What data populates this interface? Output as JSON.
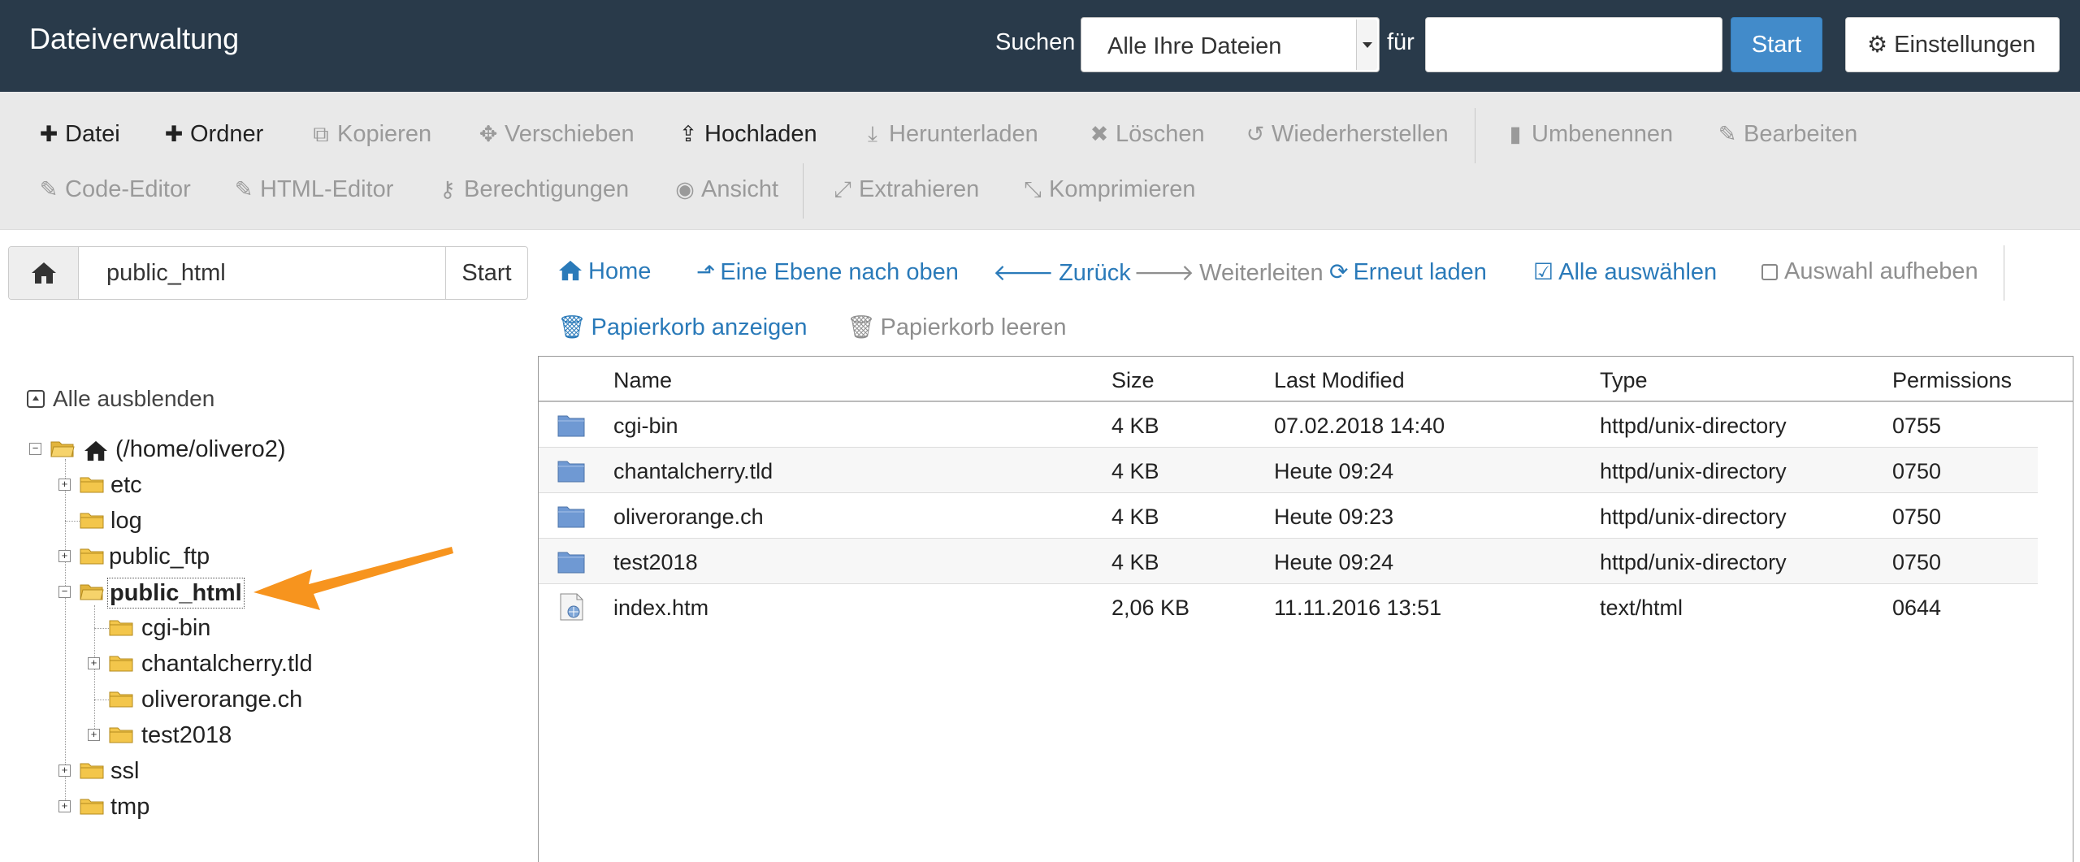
{
  "header": {
    "title": "Dateiverwaltung",
    "search_label": "Suchen",
    "search_scope": "Alle Ihre Dateien",
    "for_label": "für",
    "search_value": "",
    "start_label": "Start",
    "settings_label": "Einstellungen"
  },
  "toolbar": {
    "row1": [
      {
        "label": "Datei",
        "icon": "plus-icon",
        "enabled": true
      },
      {
        "label": "Ordner",
        "icon": "plus-icon",
        "enabled": true
      },
      {
        "label": "Kopieren",
        "icon": "copy-icon",
        "enabled": false
      },
      {
        "label": "Verschieben",
        "icon": "move-icon",
        "enabled": false
      },
      {
        "label": "Hochladen",
        "icon": "upload-icon",
        "enabled": true
      },
      {
        "label": "Herunterladen",
        "icon": "download-icon",
        "enabled": false
      },
      {
        "label": "Löschen",
        "icon": "delete-icon",
        "enabled": false
      },
      {
        "label": "Wiederherstellen",
        "icon": "restore-icon",
        "enabled": false
      },
      {
        "label": "Umbenennen",
        "icon": "file-icon",
        "enabled": false
      },
      {
        "label": "Bearbeiten",
        "icon": "pencil-icon",
        "enabled": false
      }
    ],
    "row2": [
      {
        "label": "Code-Editor",
        "icon": "edit-icon",
        "enabled": false
      },
      {
        "label": "HTML-Editor",
        "icon": "edit-icon",
        "enabled": false
      },
      {
        "label": "Berechtigungen",
        "icon": "key-icon",
        "enabled": false
      },
      {
        "label": "Ansicht",
        "icon": "eye-icon",
        "enabled": false
      },
      {
        "label": "Extrahieren",
        "icon": "expand-icon",
        "enabled": false
      },
      {
        "label": "Komprimieren",
        "icon": "compress-icon",
        "enabled": false
      }
    ]
  },
  "pathbar": {
    "path": "public_html",
    "go_label": "Start"
  },
  "nav": {
    "row1": [
      {
        "label": "Home",
        "icon": "home-icon",
        "enabled": true
      },
      {
        "label": "Eine Ebene nach oben",
        "icon": "level-up-icon",
        "enabled": true
      },
      {
        "label": "Zurück",
        "icon": "arrow-left-icon",
        "enabled": true
      },
      {
        "label": "Weiterleiten",
        "icon": "arrow-right-icon",
        "enabled": false
      },
      {
        "label": "Erneut laden",
        "icon": "refresh-icon",
        "enabled": true
      },
      {
        "label": "Alle auswählen",
        "icon": "check-square-icon",
        "enabled": true
      },
      {
        "label": "Auswahl aufheben",
        "icon": "square-icon",
        "enabled": false
      }
    ],
    "row2": [
      {
        "label": "Papierkorb anzeigen",
        "icon": "trash-icon",
        "enabled": true
      },
      {
        "label": "Papierkorb leeren",
        "icon": "trash-icon",
        "enabled": false
      }
    ]
  },
  "tree": {
    "collapse_all": "Alle ausblenden",
    "root": "(/home/olivero2)",
    "items": [
      {
        "label": "etc",
        "expandable": true
      },
      {
        "label": "log",
        "expandable": false
      },
      {
        "label": "public_ftp",
        "expandable": true
      },
      {
        "label": "public_html",
        "expandable": true,
        "expanded": true,
        "selected": true
      },
      {
        "label": "cgi-bin",
        "expandable": false
      },
      {
        "label": "chantalcherry.tld",
        "expandable": true
      },
      {
        "label": "oliverorange.ch",
        "expandable": false
      },
      {
        "label": "test2018",
        "expandable": true
      },
      {
        "label": "ssl",
        "expandable": true
      },
      {
        "label": "tmp",
        "expandable": true
      }
    ]
  },
  "files": {
    "columns": [
      "Name",
      "Size",
      "Last Modified",
      "Type",
      "Permissions"
    ],
    "rows": [
      {
        "name": "cgi-bin",
        "size": "4 KB",
        "modified": "07.02.2018 14:40",
        "type": "httpd/unix-directory",
        "perms": "0755",
        "icon": "folder-icon"
      },
      {
        "name": "chantalcherry.tld",
        "size": "4 KB",
        "modified": "Heute 09:24",
        "type": "httpd/unix-directory",
        "perms": "0750",
        "icon": "folder-icon"
      },
      {
        "name": "oliverorange.ch",
        "size": "4 KB",
        "modified": "Heute 09:23",
        "type": "httpd/unix-directory",
        "perms": "0750",
        "icon": "folder-icon"
      },
      {
        "name": "test2018",
        "size": "4 KB",
        "modified": "Heute 09:24",
        "type": "httpd/unix-directory",
        "perms": "0750",
        "icon": "folder-icon"
      },
      {
        "name": "index.htm",
        "size": "2,06 KB",
        "modified": "11.11.2016 13:51",
        "type": "text/html",
        "perms": "0644",
        "icon": "html-file-icon"
      }
    ]
  },
  "colors": {
    "header_bg": "#293a4a",
    "accent": "#428bca",
    "link": "#2a7ab9",
    "annotation_arrow": "#f7941e"
  }
}
